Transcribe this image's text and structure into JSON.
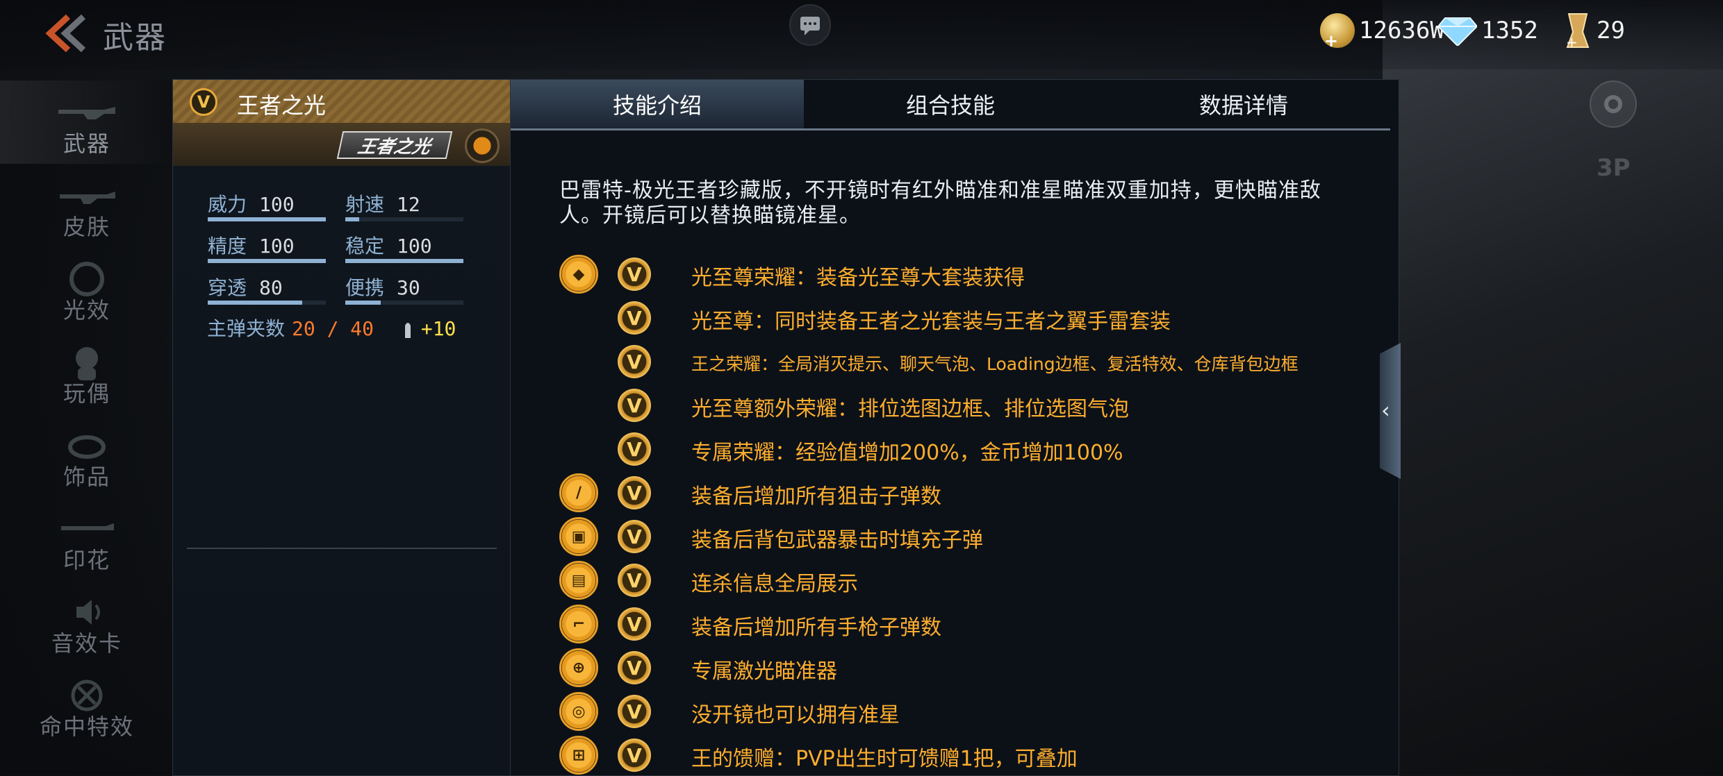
{
  "header": {
    "title": "武器"
  },
  "currency": {
    "gold": "12636W",
    "diamonds": "1352",
    "tickets": "29"
  },
  "sidebar": {
    "items": [
      {
        "label": "武器",
        "active": true
      },
      {
        "label": "皮肤"
      },
      {
        "label": "光效"
      },
      {
        "label": "玩偶"
      },
      {
        "label": "饰品"
      },
      {
        "label": "印花"
      },
      {
        "label": "音效卡"
      },
      {
        "label": "命中特效"
      }
    ]
  },
  "weapon": {
    "name": "王者之光",
    "badge": "V",
    "logo_text": "王者之光",
    "stats": [
      {
        "label": "威力",
        "value": "100",
        "fill": 1.0
      },
      {
        "label": "射速",
        "value": "12",
        "fill": 0.12
      },
      {
        "label": "精度",
        "value": "100",
        "fill": 1.0
      },
      {
        "label": "稳定",
        "value": "100",
        "fill": 1.0
      },
      {
        "label": "穿透",
        "value": "80",
        "fill": 0.8
      },
      {
        "label": "便携",
        "value": "30",
        "fill": 0.3
      }
    ],
    "ammo_label": "主弹夹数",
    "ammo_value": "20 / 40",
    "ammo_bonus": "+10"
  },
  "tabs": [
    {
      "label": "技能介绍",
      "active": true
    },
    {
      "label": "组合技能"
    },
    {
      "label": "数据详情"
    }
  ],
  "description": "巴雷特-极光王者珍藏版，不开镜时有红外瞄准和准星瞄准双重加持，更快瞄准敌人。开镜后可以替换瞄镜准星。",
  "skills": [
    {
      "icon": "diamond-icon",
      "text": "光至尊荣耀：装备光至尊大套装获得"
    },
    {
      "icon": "",
      "text": "光至尊：同时装备王者之光套装与王者之翼手雷套装"
    },
    {
      "icon": "",
      "text": "王之荣耀：全局消灭提示、聊天气泡、Loading边框、复活特效、仓库背包边框"
    },
    {
      "icon": "",
      "text": "光至尊额外荣耀：排位选图边框、排位选图气泡"
    },
    {
      "icon": "",
      "text": "专属荣耀：经验值增加200%，金币增加100%"
    },
    {
      "icon": "sniper-bullet-icon",
      "text": "装备后增加所有狙击子弹数"
    },
    {
      "icon": "backpack-icon",
      "text": "装备后背包武器暴击时填充子弹"
    },
    {
      "icon": "killfeed-icon",
      "text": "连杀信息全局展示"
    },
    {
      "icon": "pistol-icon",
      "text": "装备后增加所有手枪子弹数"
    },
    {
      "icon": "laser-sight-icon",
      "text": "专属激光瞄准器"
    },
    {
      "icon": "crosshair-icon",
      "text": "没开镜也可以拥有准星"
    },
    {
      "icon": "gift-icon",
      "text": "王的馈赠：PVP出生时可馈赠1把，可叠加"
    }
  ],
  "view_mode": "3P",
  "colors": {
    "accent_gold": "#ffae2e",
    "stat_blue": "#8fb2d4",
    "ammo_orange": "#ff7a2e",
    "bonus_yellow": "#ffe14a"
  }
}
